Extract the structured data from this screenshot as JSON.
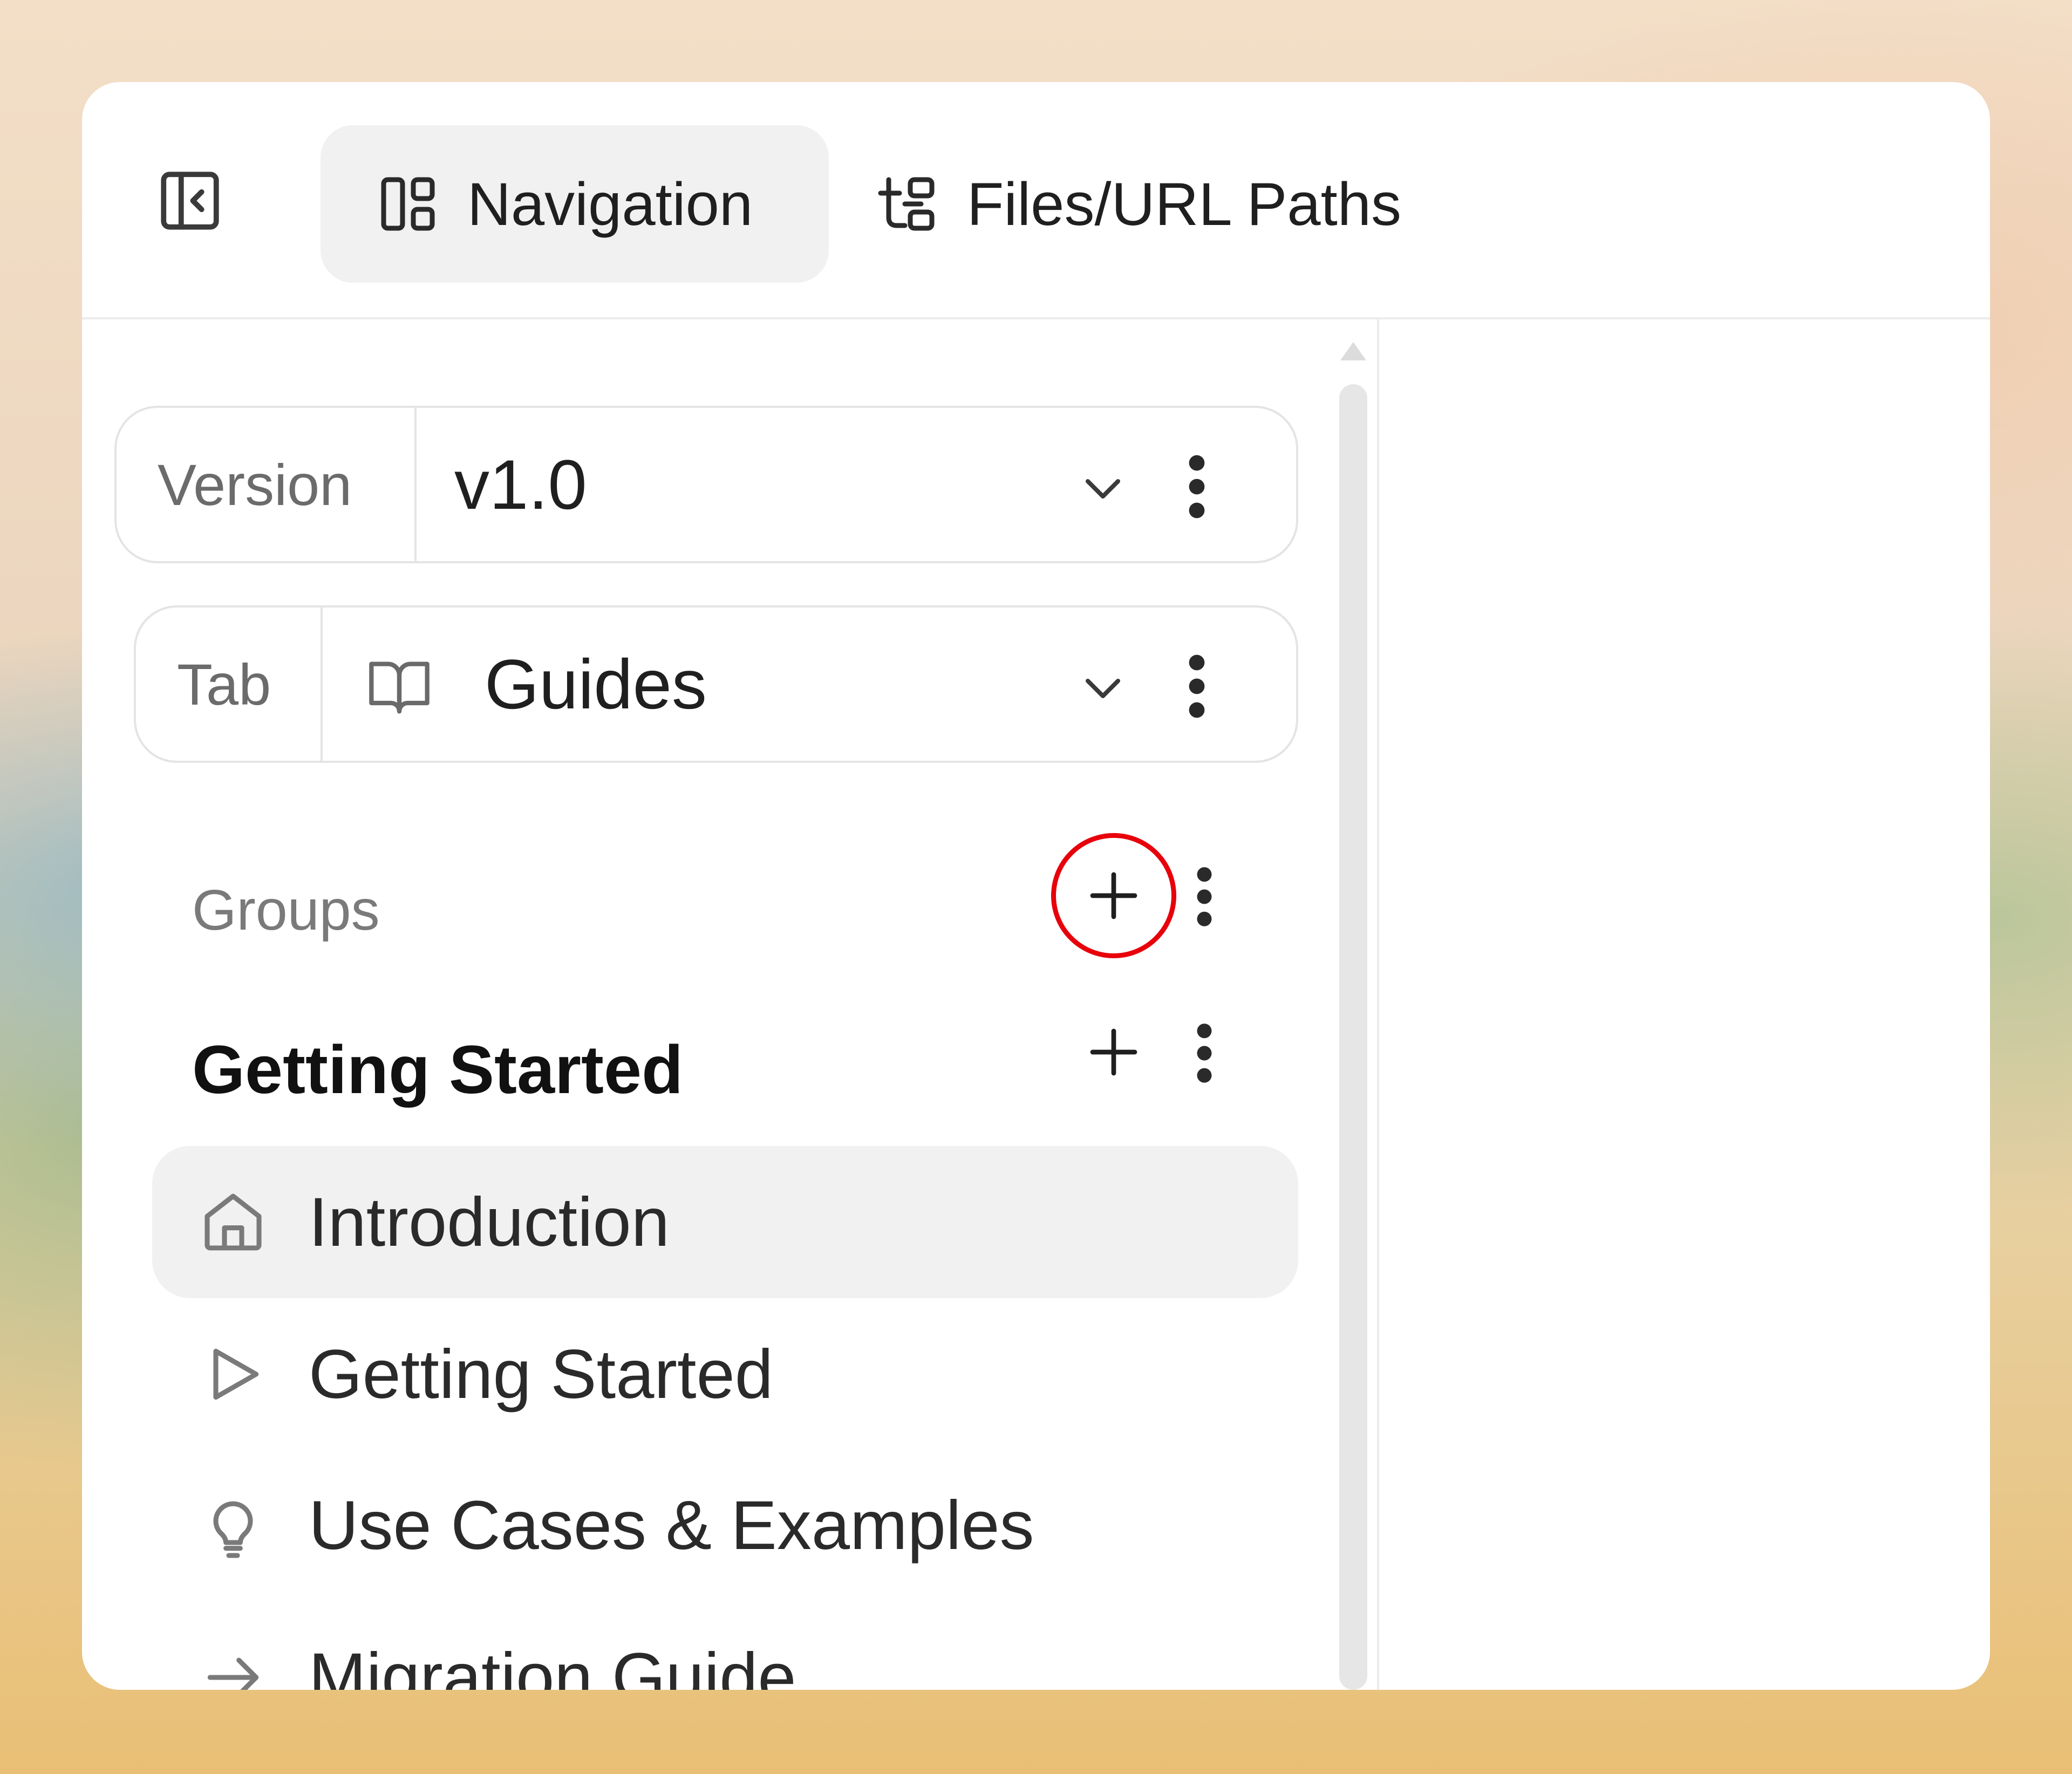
{
  "header": {
    "tabs": [
      {
        "label": "Navigation",
        "icon": "layout-panels-icon",
        "active": true
      },
      {
        "label": "Files/URL Paths",
        "icon": "file-tree-icon",
        "active": false
      }
    ]
  },
  "version_select": {
    "label": "Version",
    "value": "v1.0"
  },
  "tab_select": {
    "label": "Tab",
    "value": "Guides",
    "icon": "book-open-icon"
  },
  "groups": {
    "label": "Groups",
    "items": [
      {
        "title": "Getting Started",
        "pages": [
          {
            "label": "Introduction",
            "icon": "home-icon",
            "active": true
          },
          {
            "label": "Getting Started",
            "icon": "play-icon",
            "active": false
          },
          {
            "label": "Use Cases & Examples",
            "icon": "lightbulb-icon",
            "active": false
          },
          {
            "label": "Migration Guide",
            "icon": "arrow-right-icon",
            "active": false
          }
        ]
      }
    ]
  },
  "colors": {
    "annotation": "#e8000b",
    "active_bg": "#f1f1f1"
  }
}
